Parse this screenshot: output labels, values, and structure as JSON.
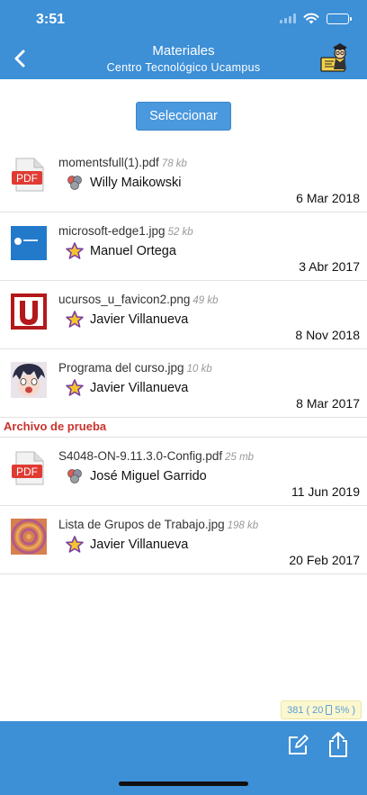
{
  "status": {
    "time": "3:51"
  },
  "header": {
    "title": "Materiales",
    "subtitle": "Centro Tecnológico Ucampus",
    "back_icon": "chevron-left-icon",
    "profile_icon": "teacher-avatar-icon"
  },
  "select_button": {
    "label": "Seleccionar"
  },
  "files": [
    {
      "name": "momentsfull(1).pdf",
      "size": "78 kb",
      "user": "Willy Maikowski",
      "user_icon": "group-icon",
      "date": "6 Mar 2018",
      "thumb": "pdf"
    },
    {
      "name": "microsoft-edge1.jpg",
      "size": "52 kb",
      "user": "Manuel Ortega",
      "user_icon": "star-icon",
      "date": "3 Abr 2017",
      "thumb": "edge"
    },
    {
      "name": "ucursos_u_favicon2.png",
      "size": "49 kb",
      "user": "Javier Villanueva",
      "user_icon": "star-icon",
      "date": "8 Nov 2018",
      "thumb": "ucursos"
    },
    {
      "name": "Programa del curso.jpg",
      "size": "10 kb",
      "user": "Javier Villanueva",
      "user_icon": "star-icon",
      "date": "8 Mar 2017",
      "thumb": "anime"
    }
  ],
  "section": {
    "title": "Archivo de prueba",
    "files": [
      {
        "name": "S4048-ON-9.11.3.0-Config.pdf",
        "size": "25 mb",
        "user": "José Miguel Garrido",
        "user_icon": "group-icon",
        "date": "11 Jun 2019",
        "thumb": "pdf"
      },
      {
        "name": "Lista de Grupos de Trabajo.jpg",
        "size": "198 kb",
        "user": "Javier Villanueva",
        "user_icon": "star-icon",
        "date": "20 Feb 2017",
        "thumb": "rings"
      }
    ]
  },
  "footer": {
    "count": "381",
    "inner_count": "20",
    "percent": "5%"
  },
  "toolbar": {
    "edit_icon": "edit-icon",
    "share_icon": "share-icon"
  },
  "colors": {
    "bar": "#3d8fd6",
    "button": "#4a98de",
    "section": "#c8332c",
    "badge_bg": "#fbf7cf"
  }
}
